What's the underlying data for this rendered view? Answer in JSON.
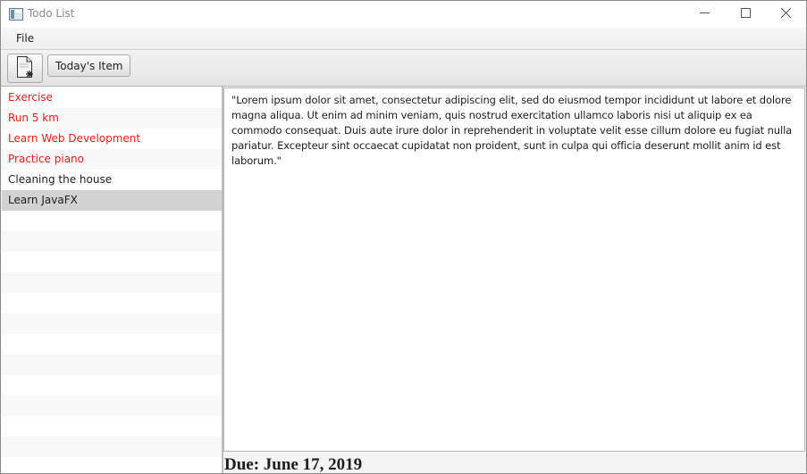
{
  "window": {
    "title": "Todo List",
    "icon": "app-window-icon",
    "controls": [
      "minimize-icon",
      "maximize-icon",
      "close-icon"
    ]
  },
  "menu": {
    "file_label": "File"
  },
  "toolbar": {
    "new_item_icon": "new-document-icon",
    "today_label": "Today's Item"
  },
  "todo_list": {
    "items": [
      {
        "label": "Exercise",
        "color": "#e0201c"
      },
      {
        "label": "Run 5 km",
        "color": "#e0201c"
      },
      {
        "label": "Learn Web Development",
        "color": "#e0201c"
      },
      {
        "label": "Practice piano",
        "color": "#e0201c"
      },
      {
        "label": "Cleaning the house",
        "color": "#1c1c1c"
      },
      {
        "label": "Learn JavaFX",
        "color": "#1c1c1c",
        "selected": true
      }
    ]
  },
  "details": {
    "text": "\"Lorem ipsum dolor sit amet, consectetur adipiscing elit, sed do eiusmod tempor incididunt ut labore et dolore magna aliqua. Ut enim ad minim veniam, quis nostrud exercitation ullamco laboris nisi ut aliquip ex ea commodo consequat. Duis aute irure dolor in reprehenderit in voluptate velit esse cillum dolore eu fugiat nulla pariatur. Excepteur sint occaecat cupidatat non proident, sunt in culpa qui officia deserunt mollit anim id est laborum.\"",
    "due": "Due: June 17, 2019"
  },
  "colors": {
    "overdue_text": "#e0201c",
    "selection": "#d2d2d2"
  }
}
